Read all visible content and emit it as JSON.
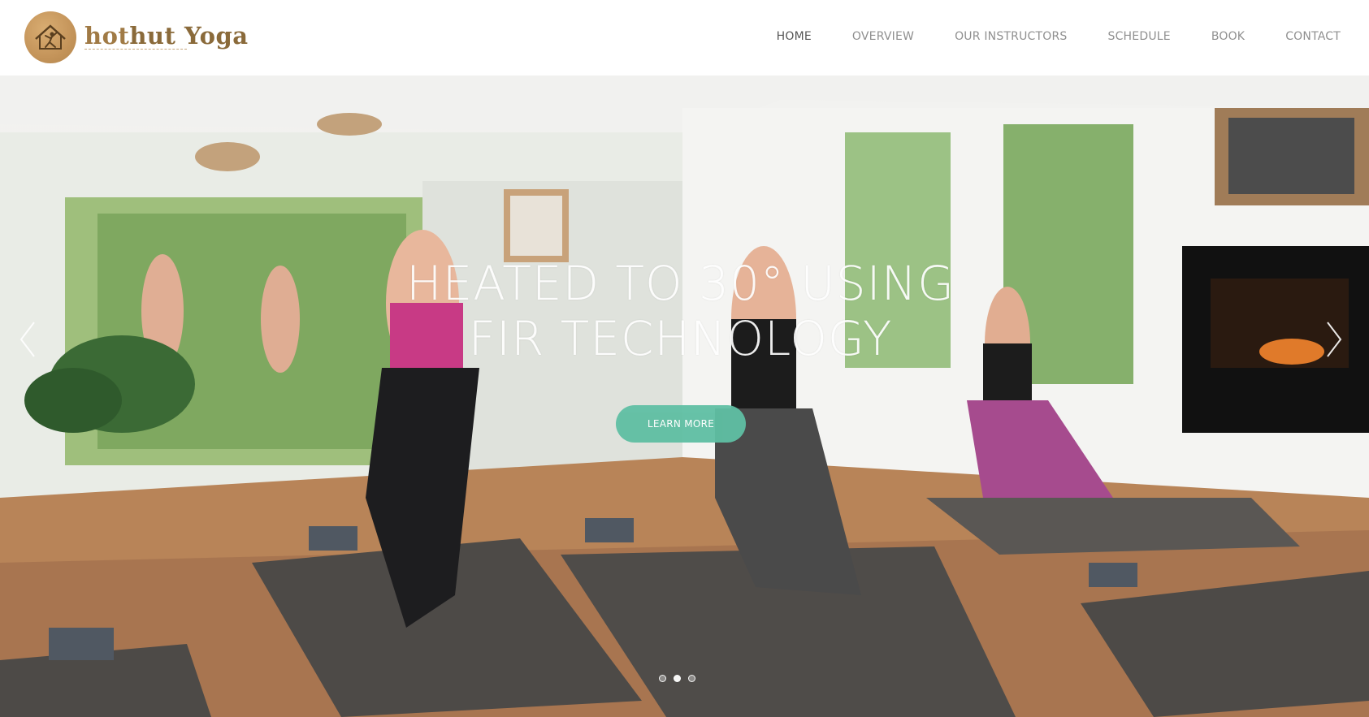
{
  "brand": {
    "name_hot": "hot",
    "name_rest": "hut Yoga",
    "logo_icon": "house-yoga-pose-icon"
  },
  "nav": {
    "items": [
      {
        "label": "HOME",
        "active": true
      },
      {
        "label": "OVERVIEW",
        "active": false
      },
      {
        "label": "OUR INSTRUCTORS",
        "active": false
      },
      {
        "label": "SCHEDULE",
        "active": false
      },
      {
        "label": "BOOK",
        "active": false
      },
      {
        "label": "CONTACT",
        "active": false
      }
    ]
  },
  "hero": {
    "title_line1": "HEATED TO 30° USING",
    "title_line2": "FIR TECHNOLOGY",
    "cta_label": "LEARN MORE",
    "prev_icon": "chevron-left-icon",
    "next_icon": "chevron-right-icon",
    "slides": 3,
    "active_slide": 2
  },
  "colors": {
    "accent": "#5fbfa3",
    "nav_text": "#8f8f8f",
    "brand_brown": "#8a6a3a"
  }
}
